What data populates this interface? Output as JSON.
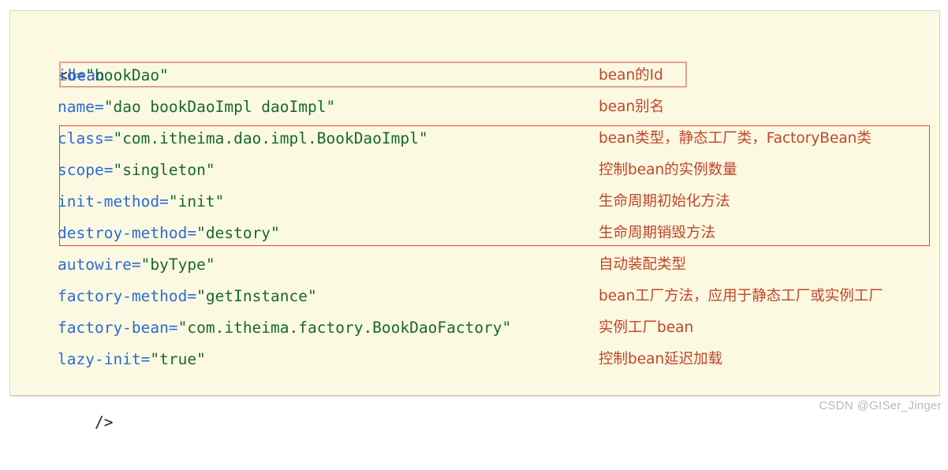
{
  "code_block": {
    "open_tag": {
      "bracket": "<",
      "name": "bean"
    },
    "close_tag": "/>",
    "attributes": [
      {
        "name": "id",
        "eq": "=",
        "value": "\"bookDao\"",
        "annotation": "bean的Id",
        "highlighted": true,
        "highlight_style": "light"
      },
      {
        "name": "name",
        "eq": "=",
        "value": "\"dao bookDaoImpl daoImpl\"",
        "annotation": "bean别名",
        "highlighted": false,
        "highlight_style": ""
      },
      {
        "name": "class",
        "eq": "=",
        "value": "\"com.itheima.dao.impl.BookDaoImpl\"",
        "annotation": "bean类型，静态工厂类，FactoryBean类",
        "highlighted": true,
        "highlight_style": "strong"
      },
      {
        "name": "scope",
        "eq": "=",
        "value": "\"singleton\"",
        "annotation": "控制bean的实例数量",
        "highlighted": true,
        "highlight_style": "strong"
      },
      {
        "name": "init-method",
        "eq": "=",
        "value": "\"init\"",
        "annotation": "生命周期初始化方法",
        "highlighted": true,
        "highlight_style": "strong"
      },
      {
        "name": "destroy-method",
        "eq": "=",
        "value": "\"destory\"",
        "annotation": "生命周期销毁方法",
        "highlighted": true,
        "highlight_style": "strong"
      },
      {
        "name": "autowire",
        "eq": "=",
        "value": "\"byType\"",
        "annotation": "自动装配类型",
        "highlighted": false,
        "highlight_style": ""
      },
      {
        "name": "factory-method",
        "eq": "=",
        "value": "\"getInstance\"",
        "annotation": "bean工厂方法，应用于静态工厂或实例工厂",
        "highlighted": false,
        "highlight_style": ""
      },
      {
        "name": "factory-bean",
        "eq": "=",
        "value": "\"com.itheima.factory.BookDaoFactory\"",
        "annotation": "实例工厂bean",
        "highlighted": false,
        "highlight_style": ""
      },
      {
        "name": "lazy-init",
        "eq": "=",
        "value": "\"true\"",
        "annotation": "控制bean延迟加载",
        "highlighted": false,
        "highlight_style": ""
      }
    ]
  },
  "watermark": {
    "text": "CSDN @GISer_Jinger"
  },
  "colors": {
    "background": "#FCF9E2",
    "attribute_name": "#2B6BD4",
    "attribute_value": "#17682F",
    "tag_name": "#2B58C6",
    "annotation": "#C0462A",
    "highlight_light": "#E8A093",
    "highlight_strong": "#E0452A",
    "watermark": "#b9b9b9"
  }
}
